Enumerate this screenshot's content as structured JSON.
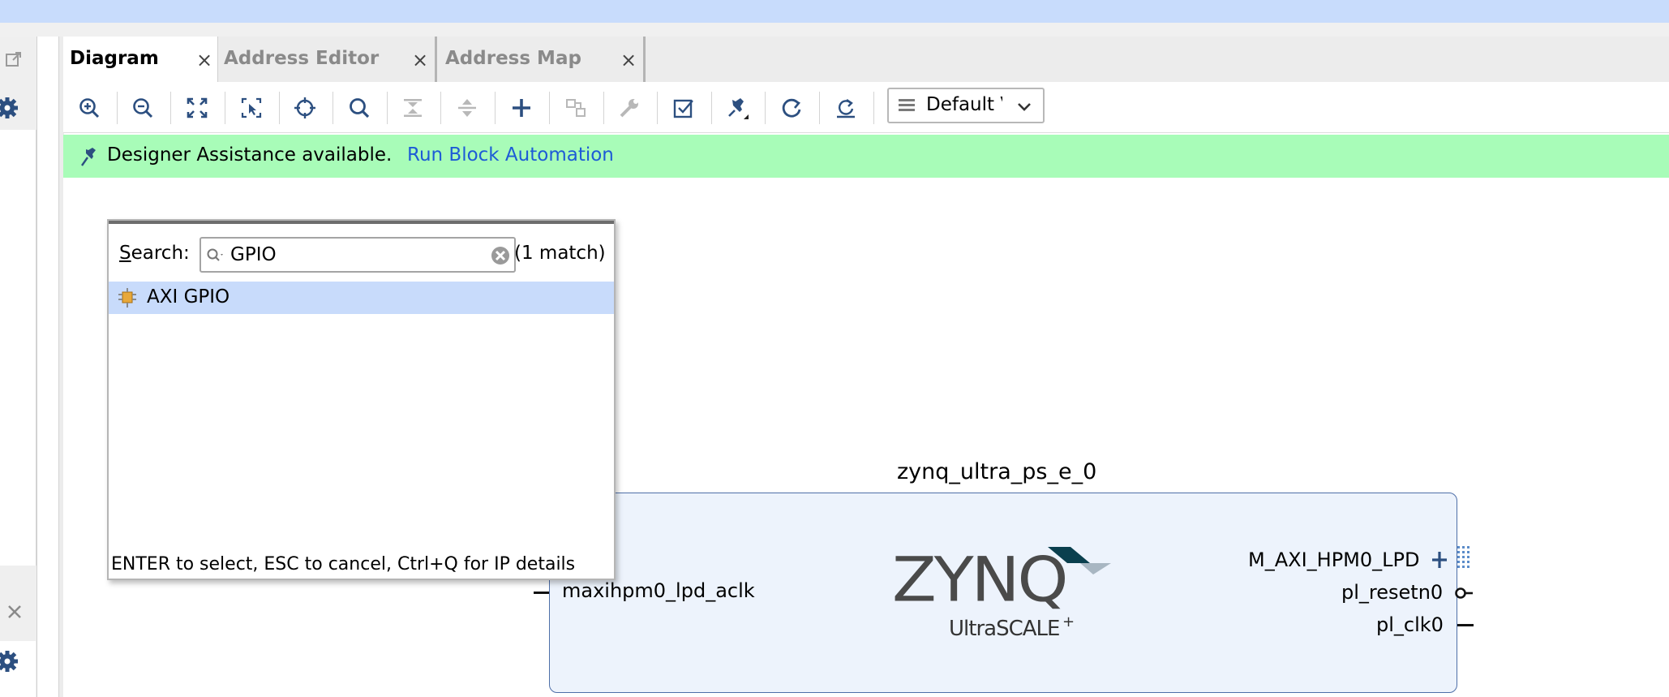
{
  "left_panel": {
    "icons": [
      "popout-icon",
      "gear-icon",
      "close-icon",
      "gear-icon"
    ]
  },
  "tabs": [
    {
      "label": "Diagram",
      "active": true,
      "close": "×"
    },
    {
      "label": "Address Editor",
      "active": false,
      "close": "×"
    },
    {
      "label": "Address Map",
      "active": false,
      "close": "×"
    }
  ],
  "toolbar": {
    "buttons": [
      "zoom-in-icon",
      "zoom-out-icon",
      "zoom-fit-icon",
      "zoom-area-icon",
      "auto-fit-selection-icon",
      "search-icon",
      "collapse-all-icon",
      "expand-all-icon",
      "add-ip-icon",
      "make-connection-icon",
      "properties-icon",
      "validate-design-icon",
      "autoconnect-pin-icon",
      "regenerate-layout-icon",
      "refresh-icon"
    ],
    "view_dropdown": "Default View"
  },
  "banner": {
    "message": "Designer Assistance available.",
    "link": "Run Block Automation",
    "bg_color": "#a8fcb8"
  },
  "popup": {
    "search_label": "Search:",
    "search_label_mnemonic": "S",
    "search_label_rest": "earch:",
    "search_value": "GPIO",
    "match_count": "(1 match)",
    "results": [
      "AXI GPIO"
    ],
    "hint": "ENTER to select, ESC to cancel, Ctrl+Q for IP details"
  },
  "block": {
    "name": "zynq_ultra_ps_e_0",
    "logo_text": "ZYNQ",
    "logo_sub": "UltraSCALE",
    "logo_plus": "+",
    "input_ports": [
      "maxihpm0_lpd_aclk"
    ],
    "output_ports": [
      "M_AXI_HPM0_LPD",
      "pl_resetn0",
      "pl_clk0"
    ],
    "fill_color": "#edf3fc",
    "border_color": "#4e6fa8"
  },
  "colors": {
    "title_bar": "#c8dcfc",
    "accent_icon": "#2c4f80",
    "selection": "#c8dbfb",
    "link": "#1d5bd6"
  }
}
